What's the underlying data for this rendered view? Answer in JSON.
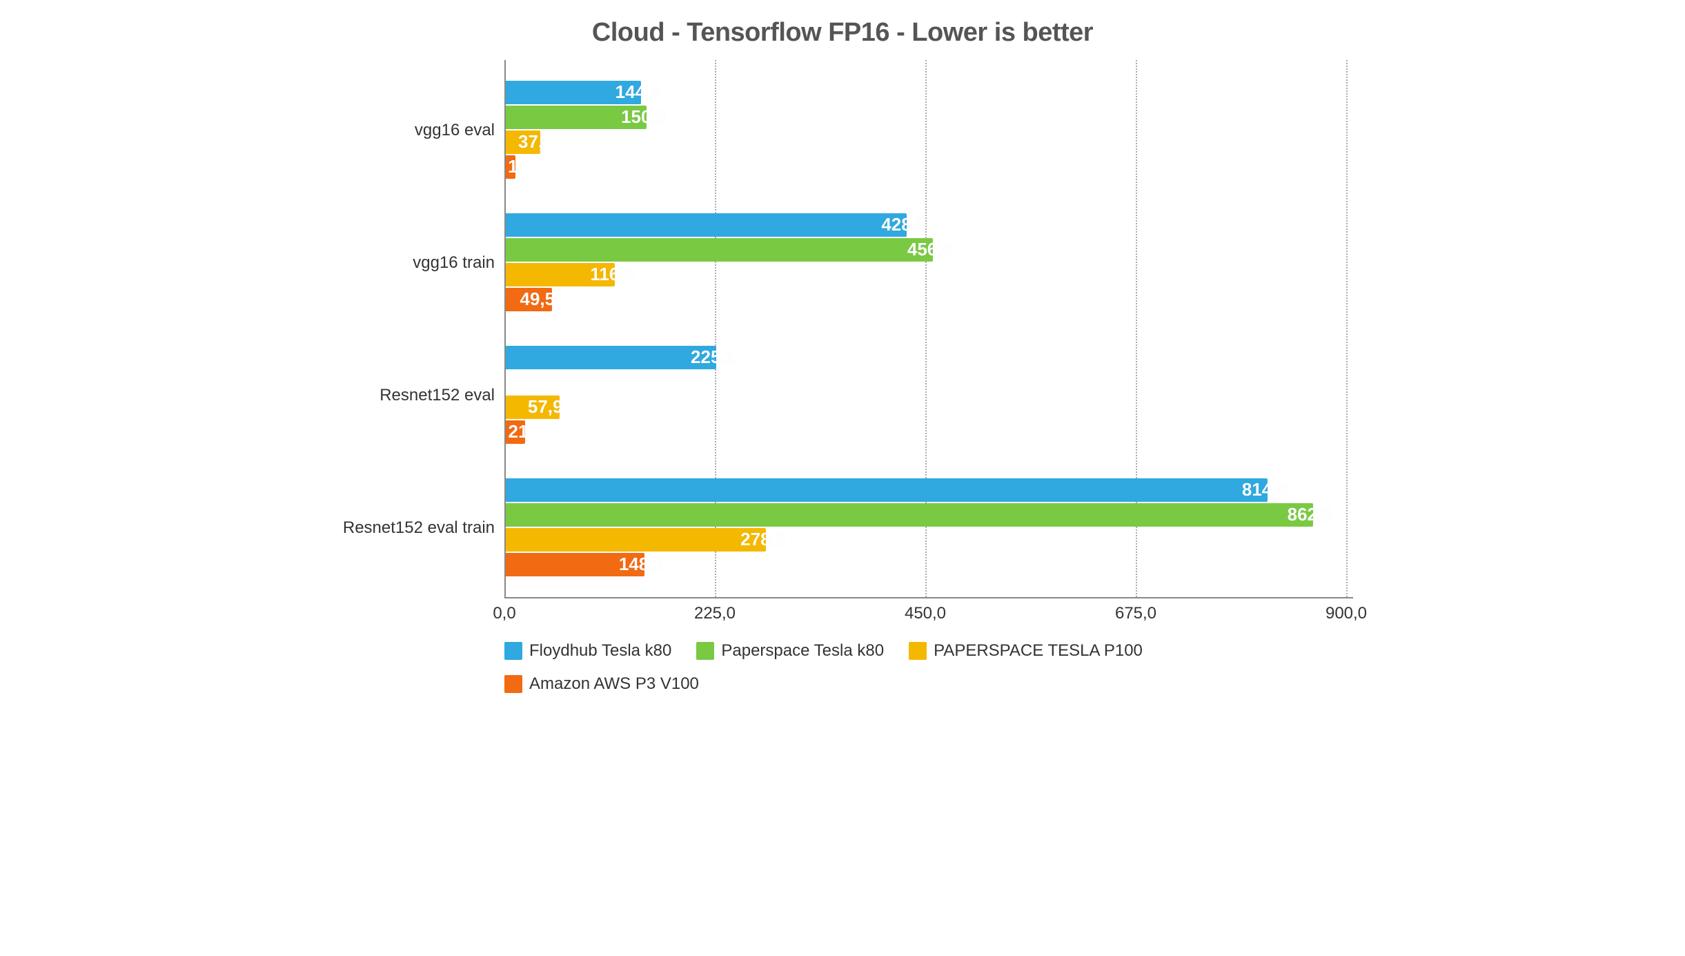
{
  "chart_data": {
    "type": "bar",
    "orientation": "horizontal",
    "title": "Cloud - Tensorflow FP16 - Lower is better",
    "xlabel": "",
    "ylabel": "",
    "xlim": [
      0,
      900
    ],
    "xticks": [
      "0,0",
      "225,0",
      "450,0",
      "675,0",
      "900,0"
    ],
    "categories": [
      "vgg16 eval",
      "vgg16 train",
      "Resnet152 eval",
      "Resnet152 eval train"
    ],
    "series": [
      {
        "name": "Floydhub Tesla k80",
        "color": "#2fa9e0",
        "values": [
          144.4,
          428.9,
          225.1,
          814.4
        ],
        "labels": [
          "144,4",
          "428,9",
          "225,1",
          "814,4"
        ]
      },
      {
        "name": "Paperspace Tesla k80",
        "color": "#7ac943",
        "values": [
          150.6,
          456.6,
          null,
          862.9
        ],
        "labels": [
          "150,6",
          "456,6",
          "",
          "862,9"
        ]
      },
      {
        "name": "PAPERSPACE TESLA P100",
        "color": "#f5b800",
        "values": [
          37.0,
          116.6,
          57.9,
          278.3
        ],
        "labels": [
          "37,",
          "116,6",
          "57,9",
          "278,3"
        ]
      },
      {
        "name": "Amazon AWS P3 V100",
        "color": "#f26a12",
        "values": [
          10.0,
          49.5,
          21.0,
          148.2
        ],
        "labels": [
          "1",
          "49,5",
          "21",
          "148,2"
        ]
      }
    ],
    "legend_position": "bottom",
    "grid": true
  }
}
